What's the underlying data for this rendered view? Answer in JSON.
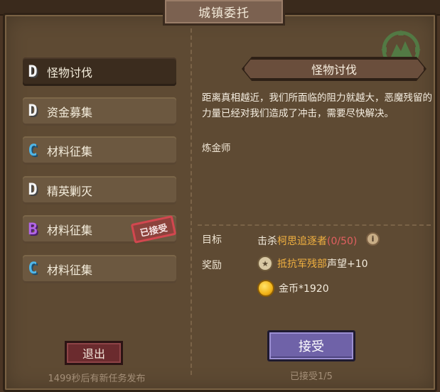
{
  "window": {
    "title": "城镇委托"
  },
  "quests": [
    {
      "rank": "D",
      "name": "怪物讨伐",
      "selected": true,
      "accepted": false
    },
    {
      "rank": "D",
      "name": "资金募集",
      "selected": false,
      "accepted": false
    },
    {
      "rank": "C",
      "name": "材料征集",
      "selected": false,
      "accepted": false
    },
    {
      "rank": "D",
      "name": "精英剿灭",
      "selected": false,
      "accepted": false
    },
    {
      "rank": "B",
      "name": "材料征集",
      "selected": false,
      "accepted": true,
      "stamp": "已接受"
    },
    {
      "rank": "C",
      "name": "材料征集",
      "selected": false,
      "accepted": false
    }
  ],
  "footer_left": {
    "exit_label": "退出",
    "timer_text": "1499秒后有新任务发布"
  },
  "detail": {
    "title": "怪物讨伐",
    "description": "距离真相越近，我们所面临的阻力就越大，恶魔残留的力量已经对我们造成了冲击，需要尽快解决。",
    "giver": "炼金师",
    "goal_label": "目标",
    "goal_prefix": "击杀",
    "goal_target": "柯思追逐者",
    "goal_progress": "(0/50)",
    "reward_label": "奖励",
    "reward_rep_faction": "抵抗军残部",
    "reward_rep_value": "声望+10",
    "reward_gold": "金币*1920",
    "accept_label": "接受",
    "accepted_count": "已接受1/5"
  },
  "colors": {
    "rank_D": "#f4f4f4",
    "rank_C": "#4fb6e8",
    "rank_B": "#b266e6",
    "highlight": "#f0b040",
    "progress": "#e26060"
  }
}
